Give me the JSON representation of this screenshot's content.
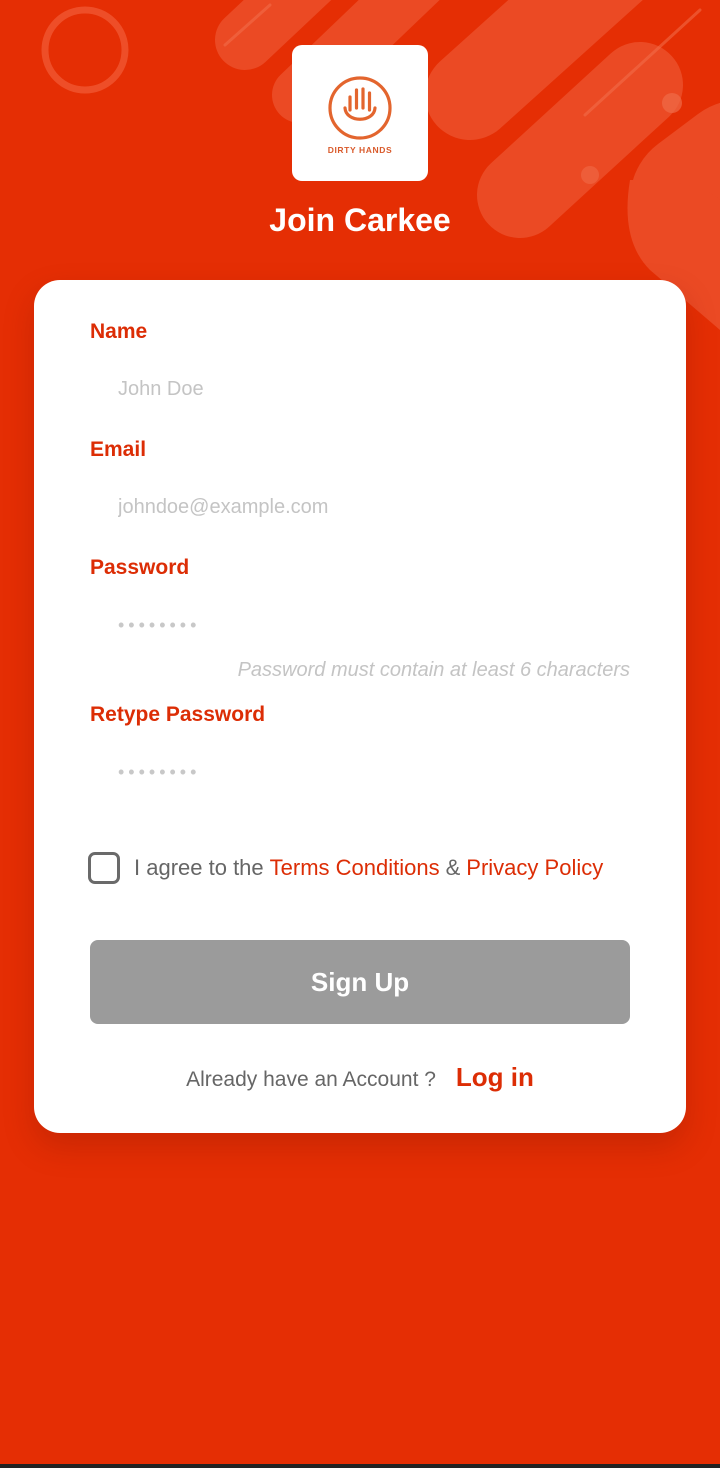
{
  "brand": {
    "logo_text": "DIRTY HANDS",
    "accent_color": "#E52E04",
    "logo_color": "#E3652E"
  },
  "page": {
    "title": "Join Carkee"
  },
  "form": {
    "name": {
      "label": "Name",
      "placeholder": "John Doe",
      "value": ""
    },
    "email": {
      "label": "Email",
      "placeholder": "johndoe@example.com",
      "value": ""
    },
    "password": {
      "label": "Password",
      "placeholder": "••••••••",
      "value": "",
      "hint": "Password must contain at least 6 characters"
    },
    "retype_password": {
      "label": "Retype Password",
      "placeholder": "••••••••",
      "value": ""
    },
    "agree": {
      "checked": false,
      "prefix": "I agree to the",
      "terms": "Terms Conditions",
      "amp": "&",
      "privacy": "Privacy Policy"
    },
    "submit_label": "Sign Up"
  },
  "login": {
    "question": "Already have an Account ?",
    "link": "Log in"
  }
}
